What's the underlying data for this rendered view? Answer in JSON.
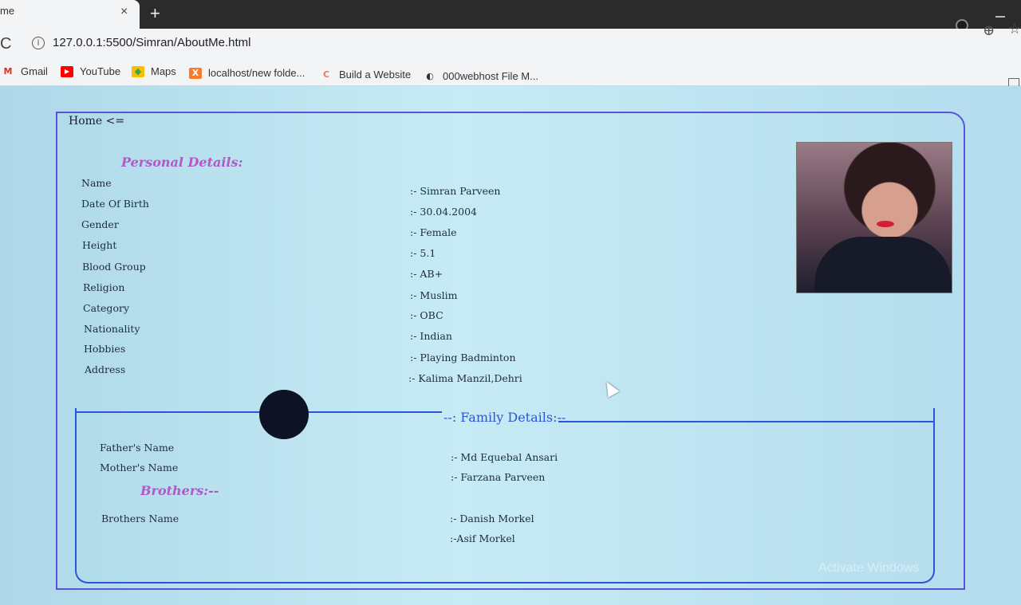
{
  "browser": {
    "tab_title": "me",
    "tab_close": "×",
    "new_tab": "+",
    "reload_glyph": "C",
    "info_glyph": "i",
    "url": "127.0.0.1:5500/Simran/AboutMe.html",
    "zoom_glyph": "⊕",
    "star_glyph": "☆",
    "bookmarks": [
      {
        "label": "Gmail",
        "icon": "gmail-icon",
        "glyph": "M",
        "color": "#d93025"
      },
      {
        "label": "YouTube",
        "icon": "youtube-icon",
        "glyph": "▶",
        "color": "#ff0000"
      },
      {
        "label": "Maps",
        "icon": "maps-icon",
        "glyph": "◆",
        "color": "#34a853"
      },
      {
        "label": "localhost/new folde...",
        "icon": "xampp-icon",
        "glyph": "X",
        "color": "#fb7a24"
      },
      {
        "label": "Build a Website",
        "icon": "build-website-icon",
        "glyph": "C",
        "color": "#e8795a"
      },
      {
        "label": "000webhost File M...",
        "icon": "webhost-icon",
        "glyph": "◐",
        "color": "#333333"
      }
    ]
  },
  "page": {
    "home_link": "Home <=",
    "personal_heading": "Personal Details:",
    "personal": [
      {
        "label": "Name",
        "value": ":- Simran Parveen"
      },
      {
        "label": "Date Of Birth",
        "value": ":- 30.04.2004"
      },
      {
        "label": "Gender",
        "value": ":- Female"
      },
      {
        "label": "Height",
        "value": ":- 5.1"
      },
      {
        "label": "Blood Group",
        "value": ":- AB+"
      },
      {
        "label": "Religion",
        "value": ":- Muslim"
      },
      {
        "label": "Category",
        "value": ":- OBC"
      },
      {
        "label": "Nationality",
        "value": ":- Indian"
      },
      {
        "label": "Hobbies",
        "value": ":- Playing Badminton"
      },
      {
        "label": "Address",
        "value": ":- Kalima Manzil,Dehri"
      }
    ],
    "family_heading": "--: Family Details:--",
    "family": [
      {
        "label": "Father's Name",
        "value": ":- Md Equebal Ansari"
      },
      {
        "label": "Mother's Name",
        "value": ":- Farzana Parveen"
      }
    ],
    "brothers_heading": "Brothers:--",
    "brothers_label": "Brothers Name",
    "brothers": [
      ":- Danish Morkel",
      ":-Asif Morkel"
    ],
    "watermark": "Activate Windows"
  },
  "colors": {
    "accent_blue": "#2c55d8",
    "heading_pink": "#b258c8",
    "outer_border": "#5a55d6"
  }
}
